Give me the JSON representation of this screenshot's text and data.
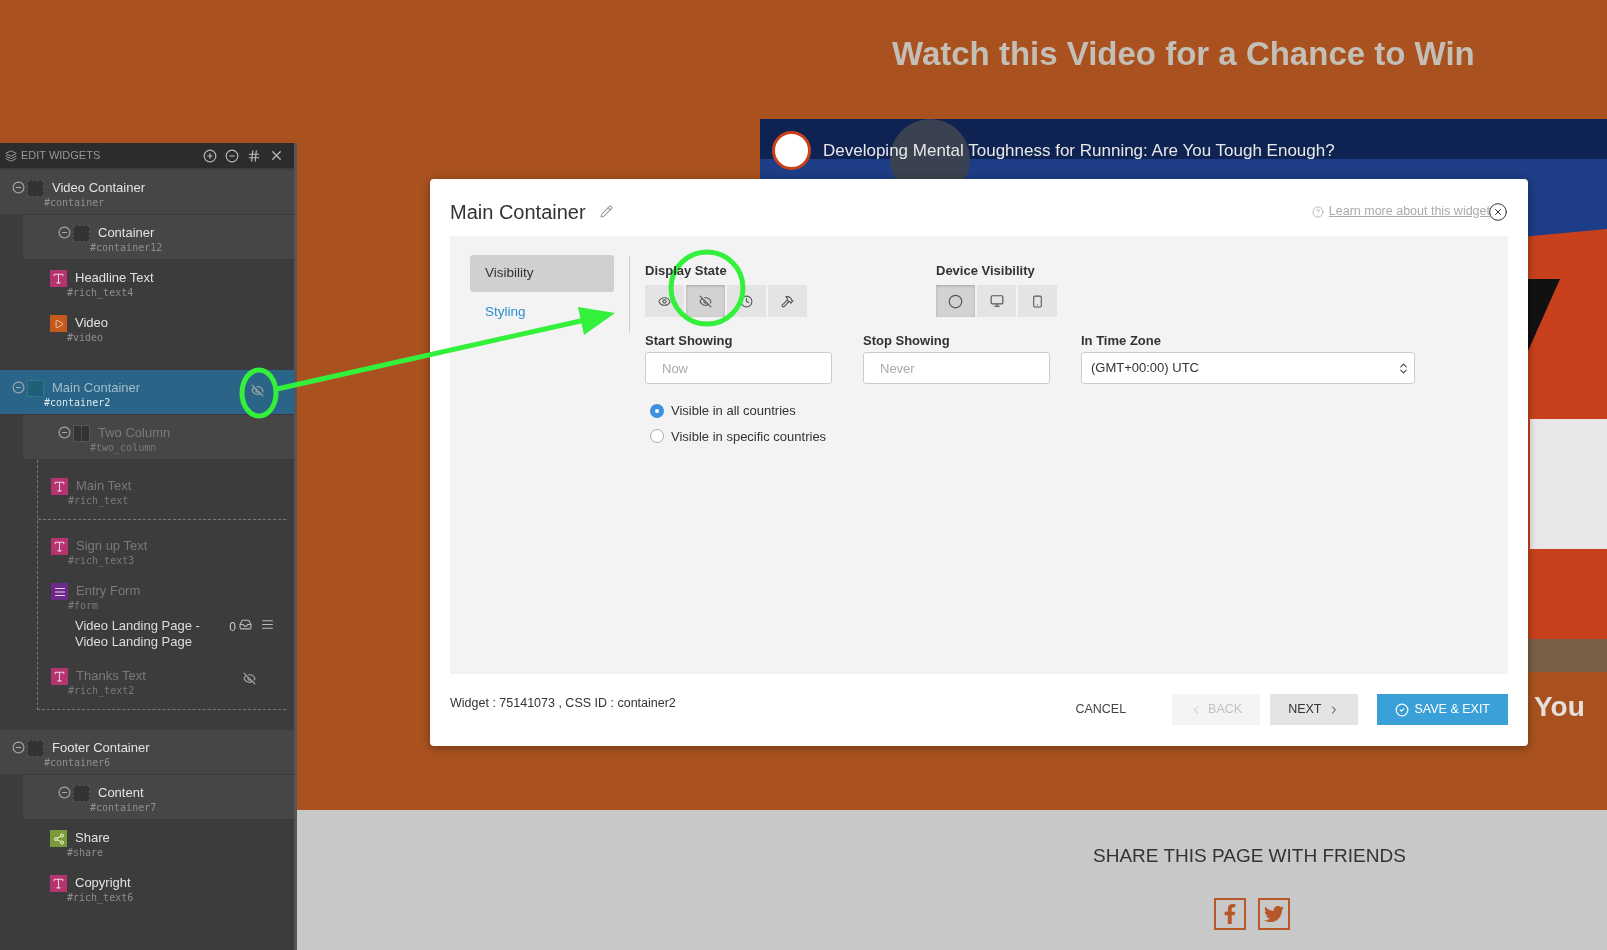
{
  "page": {
    "headline": "Watch this Video for a Chance to Win",
    "video_title": "Developing Mental Toughness for Running: Are You Tough Enough?",
    "subheading": "You",
    "share_heading": "SHARE THIS PAGE WITH FRIENDS",
    "share_buttons": [
      {
        "kind": "facebook"
      },
      {
        "kind": "twitter"
      }
    ]
  },
  "widgets_panel": {
    "title": "EDIT WIDGETS",
    "tree": [
      {
        "name": "Video Container",
        "id": "#container",
        "kind": "container",
        "expanded": true,
        "selected": false,
        "hidden": false,
        "children": [
          {
            "name": "Container",
            "id": "#container12",
            "kind": "container",
            "expanded": true,
            "selected": false,
            "hidden": false,
            "children": [
              {
                "name": "Headline Text",
                "id": "#rich_text4",
                "kind": "text",
                "selected": false,
                "hidden": false
              },
              {
                "name": "Video",
                "id": "#video",
                "kind": "video",
                "selected": false,
                "hidden": false
              }
            ]
          }
        ]
      },
      {
        "name": "Main Container",
        "id": "#container2",
        "kind": "main",
        "expanded": true,
        "selected": true,
        "hidden": true,
        "children": [
          {
            "name": "Two Column",
            "id": "#two_column",
            "kind": "columns",
            "expanded": true,
            "selected": false,
            "hidden": false,
            "children": [
              {
                "kind": "column",
                "children": [
                  {
                    "name": "Main Text",
                    "id": "#rich_text",
                    "kind": "text",
                    "selected": false,
                    "hidden": false
                  }
                ]
              },
              {
                "kind": "column",
                "children": [
                  {
                    "name": "Sign up Text",
                    "id": "#rich_text3",
                    "kind": "text",
                    "selected": false,
                    "hidden": false
                  },
                  {
                    "name": "Entry Form",
                    "id": "#form",
                    "kind": "form",
                    "selected": false,
                    "hidden": false
                  },
                  {
                    "kind": "form_info",
                    "text": "Video Landing Page - Video Landing Page",
                    "count": "0",
                    "selected": false
                  },
                  {
                    "name": "Thanks Text",
                    "id": "#rich_text2",
                    "kind": "text",
                    "selected": false,
                    "hidden": true
                  }
                ]
              }
            ]
          }
        ]
      },
      {
        "name": "Footer Container",
        "id": "#container6",
        "kind": "container",
        "expanded": true,
        "selected": false,
        "hidden": false,
        "children": [
          {
            "name": "Content",
            "id": "#container7",
            "kind": "container",
            "expanded": true,
            "selected": false,
            "hidden": false,
            "children": [
              {
                "name": "Share",
                "id": "#share",
                "kind": "share",
                "selected": false,
                "hidden": false
              },
              {
                "name": "Copyright",
                "id": "#rich_text6",
                "kind": "text",
                "selected": false,
                "hidden": false
              }
            ]
          }
        ]
      }
    ]
  },
  "dialog": {
    "title": "Main Container",
    "help_link": "Learn more about this widget",
    "tabs": [
      {
        "label": "Visibility",
        "selected": true
      },
      {
        "label": "Styling",
        "selected": false
      }
    ],
    "display_state": {
      "label": "Display State",
      "options": [
        {
          "kind": "visible",
          "selected": false
        },
        {
          "kind": "hidden",
          "selected": true
        },
        {
          "kind": "scheduled",
          "selected": false
        },
        {
          "kind": "build",
          "selected": false
        }
      ]
    },
    "device_visibility": {
      "label": "Device Visibility",
      "options": [
        {
          "kind": "all",
          "selected": true
        },
        {
          "kind": "desktop",
          "selected": false
        },
        {
          "kind": "mobile",
          "selected": false
        }
      ]
    },
    "start_showing": {
      "label": "Start Showing",
      "placeholder": "Now"
    },
    "stop_showing": {
      "label": "Stop Showing",
      "placeholder": "Never"
    },
    "time_zone": {
      "label": "In Time Zone",
      "value": "(GMT+00:00) UTC"
    },
    "country_options": [
      {
        "label": "Visible in all countries",
        "selected": true
      },
      {
        "label": "Visible in specific countries",
        "selected": false
      }
    ],
    "widget_info": "Widget : 75141073 , CSS ID : container2",
    "buttons": [
      {
        "label": "CANCEL",
        "kind": "plain",
        "disabled": false
      },
      {
        "label": "BACK",
        "kind": "back",
        "disabled": true
      },
      {
        "label": "NEXT",
        "kind": "next",
        "disabled": false
      },
      {
        "label": "SAVE & EXIT",
        "kind": "primary",
        "disabled": false
      }
    ]
  }
}
